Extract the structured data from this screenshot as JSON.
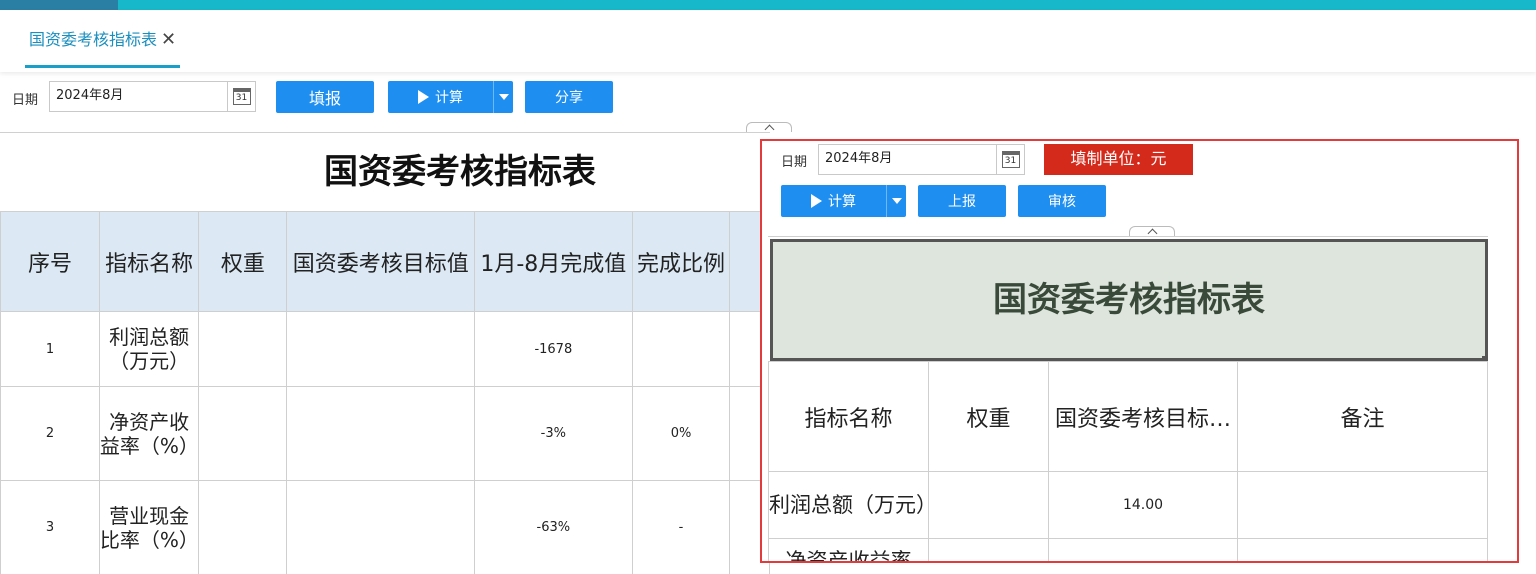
{
  "tabs": [
    {
      "label": "国资委考核指标表",
      "close": "✕"
    }
  ],
  "toolbar": {
    "date_label": "日期",
    "date_value": "2024年8月",
    "calendar_day": "31",
    "fill_label": "填报",
    "calc_label": "计算",
    "share_label": "分享"
  },
  "sheet": {
    "title": "国资委考核指标表",
    "headers": [
      "序号",
      "指标名称",
      "权重",
      "国资委考核目标值",
      "1月-8月完成值",
      "完成比例"
    ],
    "rows": [
      {
        "seq": "1",
        "name": "利润总额（万元）",
        "weight": "",
        "target": "",
        "actual": "-1678",
        "ratio": ""
      },
      {
        "seq": "2",
        "name": "净资产收益率（%）",
        "weight": "",
        "target": "",
        "actual": "-3%",
        "ratio": "0%"
      },
      {
        "seq": "3",
        "name": "营业现金比率（%）",
        "weight": "",
        "target": "",
        "actual": "-63%",
        "ratio": "-"
      }
    ]
  },
  "overlay": {
    "date_label": "日期",
    "date_value": "2024年8月",
    "calendar_day": "31",
    "unit_label": "填制单位：元",
    "calc_label": "计算",
    "report_label": "上报",
    "audit_label": "审核",
    "title": "国资委考核指标表",
    "headers": [
      "指标名称",
      "权重",
      "国资委考核目标…",
      "备注"
    ],
    "rows": [
      {
        "name": "利润总额（万元）",
        "weight": "",
        "target": "14.00",
        "remark": ""
      },
      {
        "name": "净资产收益率",
        "weight": "",
        "target": "",
        "remark": ""
      }
    ]
  },
  "colors": {
    "accent": "#1e8ff0",
    "topbar": "#17b8c9",
    "unit_badge": "#d42a1c",
    "highlight_border": "#e33b3b"
  },
  "icons": [
    "close-icon",
    "calendar-icon",
    "play-icon",
    "chevron-down-icon",
    "chevron-up-icon"
  ]
}
